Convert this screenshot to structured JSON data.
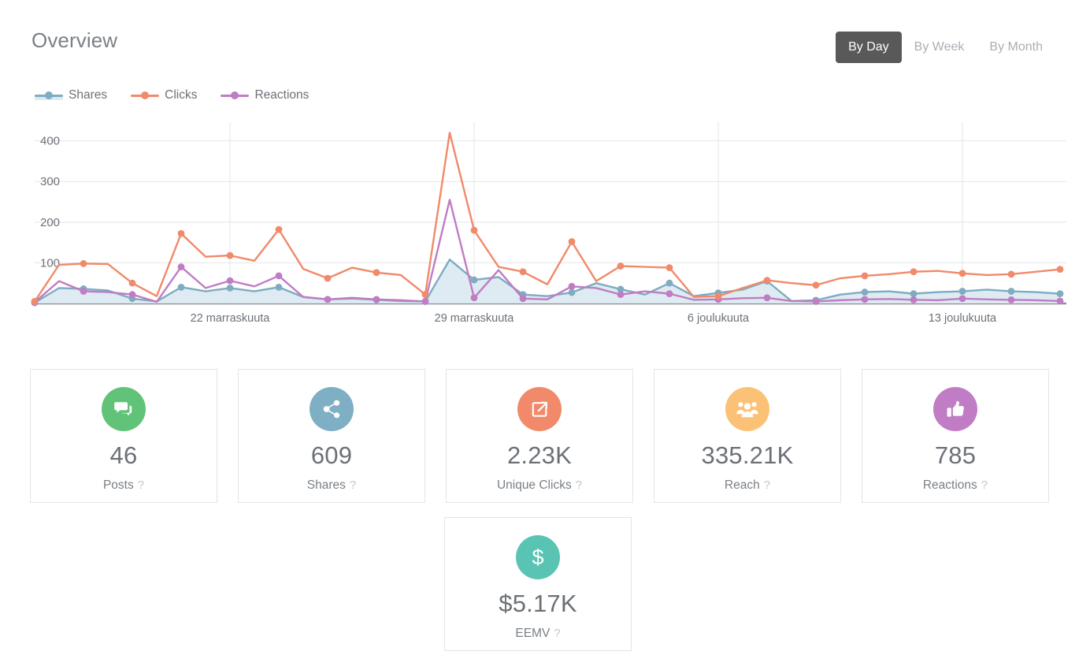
{
  "header": {
    "title": "Overview",
    "range_buttons": [
      {
        "label": "By Day",
        "active": true
      },
      {
        "label": "By Week",
        "active": false
      },
      {
        "label": "By Month",
        "active": false
      }
    ]
  },
  "colors": {
    "shares_line": "#7eacc0",
    "shares_fill": "#dceaf1",
    "clicks_line": "#f08a6a",
    "reactions_line": "#c07cc4",
    "active_button_bg": "#595959",
    "grid": "#e3e5e7",
    "axis": "#8d9298",
    "text": "#6c7177",
    "card_border": "#e2e4e6",
    "icon_posts": "#5cc островов"
  },
  "chart_data": {
    "type": "line",
    "title": "",
    "xlabel": "",
    "ylabel": "",
    "ylim": [
      0,
      440
    ],
    "yticks": [
      100,
      200,
      300,
      400
    ],
    "ytick_labels": [
      "100",
      "200",
      "300",
      "400"
    ],
    "grid": true,
    "legend_position": "top-left",
    "x_tick_labels": [
      "22 marraskuuta",
      "29 marraskuuta",
      "6 joulukuuta",
      "13 joulukuuta"
    ],
    "x_tick_indices": [
      8,
      18,
      28,
      38
    ],
    "x_count": 43,
    "series": [
      {
        "name": "Shares",
        "color": "#7eacc0",
        "fill": "#dceaf1",
        "values": [
          2,
          38,
          36,
          32,
          12,
          5,
          40,
          30,
          38,
          30,
          40,
          16,
          10,
          12,
          9,
          6,
          5,
          108,
          58,
          65,
          22,
          18,
          27,
          50,
          35,
          22,
          50,
          18,
          26,
          34,
          55,
          6,
          8,
          22,
          28,
          30,
          24,
          28,
          30,
          34,
          30,
          28,
          24
        ]
      },
      {
        "name": "Clicks",
        "color": "#f08a6a",
        "values": [
          5,
          95,
          98,
          97,
          50,
          18,
          172,
          115,
          118,
          105,
          182,
          85,
          62,
          88,
          76,
          70,
          22,
          420,
          180,
          90,
          78,
          47,
          152,
          55,
          92,
          90,
          88,
          16,
          18,
          38,
          57,
          50,
          45,
          62,
          68,
          72,
          78,
          80,
          74,
          70,
          72,
          78,
          84
        ]
      },
      {
        "name": "Reactions",
        "color": "#c07cc4",
        "values": [
          3,
          55,
          30,
          28,
          22,
          4,
          90,
          38,
          56,
          42,
          68,
          16,
          10,
          14,
          10,
          8,
          5,
          255,
          14,
          82,
          12,
          10,
          42,
          38,
          22,
          30,
          24,
          9,
          10,
          13,
          14,
          6,
          5,
          8,
          10,
          11,
          9,
          8,
          12,
          10,
          9,
          8,
          6
        ]
      }
    ]
  },
  "cards": {
    "row1": [
      {
        "icon": "speech-bubble-icon",
        "icon_bg": "#60c378",
        "value": "46",
        "label": "Posts",
        "help": "?"
      },
      {
        "icon": "share-nodes-icon",
        "icon_bg": "#7eafc4",
        "value": "609",
        "label": "Shares",
        "help": "?"
      },
      {
        "icon": "external-link-icon",
        "icon_bg": "#f08a6a",
        "value": "2.23K",
        "label": "Unique Clicks",
        "help": "?"
      },
      {
        "icon": "people-group-icon",
        "icon_bg": "#fbc277",
        "value": "335.21K",
        "label": "Reach",
        "help": "?"
      },
      {
        "icon": "thumbs-up-icon",
        "icon_bg": "#c07cc4",
        "value": "785",
        "label": "Reactions",
        "help": "?"
      }
    ],
    "row2": [
      {
        "icon": "dollar-sign-icon",
        "icon_bg": "#59c4b4",
        "value": "$5.17K",
        "label": "EEMV",
        "help": "?"
      }
    ]
  }
}
